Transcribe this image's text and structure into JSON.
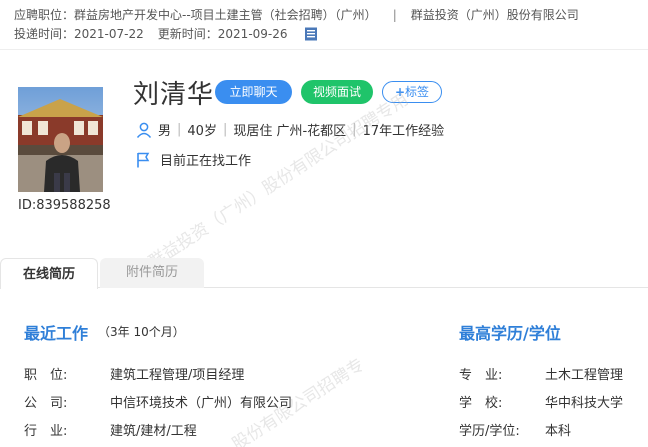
{
  "header": {
    "applied_label": "应聘职位：",
    "applied_position": "群益房地产开发中心--项目土建主管（社会招聘）（广州）",
    "separator": "|",
    "company": "群益投资（广州）股份有限公司",
    "submit_label": "投递时间：",
    "submit_date": "2021-07-22",
    "update_label": "更新时间：",
    "update_date": "2021-09-26",
    "doc_icon": "document-icon"
  },
  "profile": {
    "name": "刘清华",
    "id_text": "ID:839588258",
    "chat_button": "立即聊天",
    "video_button": "视频面试",
    "tag_button": "标签",
    "gender": "男",
    "age": "40岁",
    "residence": "现居住 广州-花都区",
    "experience": "17年工作经验",
    "status": "目前正在找工作"
  },
  "tabs": {
    "online": "在线简历",
    "attachment": "附件简历"
  },
  "recent_work": {
    "title": "最近工作",
    "duration": "（3年 10个月）",
    "rows": [
      {
        "label": "职　位:",
        "value": "建筑工程管理/项目经理"
      },
      {
        "label": "公　司:",
        "value": "中信环境技术（广州）有限公司"
      },
      {
        "label": "行　业:",
        "value": "建筑/建材/工程"
      }
    ]
  },
  "education": {
    "title": "最高学历/学位",
    "rows": [
      {
        "label": "专　业:",
        "value": "土木工程管理"
      },
      {
        "label": "学　校:",
        "value": "华中科技大学"
      },
      {
        "label": "学历/学位:",
        "value": "本科"
      }
    ]
  },
  "watermark": {
    "text1": "群益投资（广州）股份有限公司招聘专用",
    "text2": "股份有限公司招聘专"
  },
  "colors": {
    "accent_blue": "#3a8ef0",
    "accent_green": "#1fc46a",
    "section_title": "#2f7fd8"
  }
}
